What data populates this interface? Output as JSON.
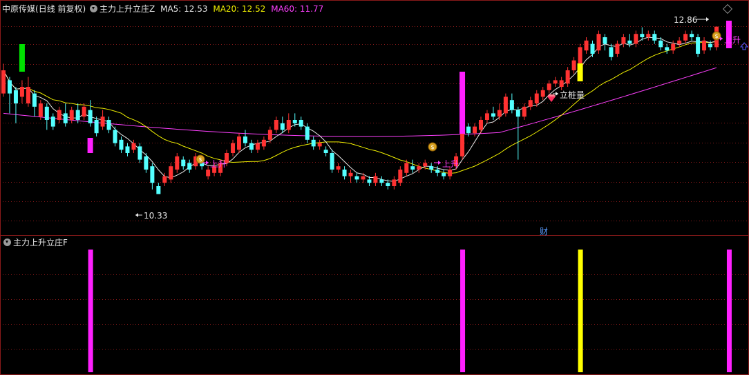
{
  "main_panel": {
    "stock_name": "中原传媒",
    "period": "(日线 前复权)",
    "indicator": "主力上升立庄Z",
    "ma5": "MA5: 12.53",
    "ma20": "MA20: 12.52",
    "ma60": "MA60: 11.77",
    "high_label": "12.86",
    "low_label": "10.33",
    "signal_rise": "上升",
    "signal_stake": "立桩量",
    "finance_marker": "财"
  },
  "sub_panel": {
    "indicator": "主力上升立庄F"
  },
  "colors": {
    "up": "#ff3232",
    "down": "#54ffff",
    "ma5": "#e8e8e8",
    "ma20": "#f0f000",
    "ma60": "#ff40ff",
    "grid": "#8b1a1a",
    "signal_magenta": "#ff20ff",
    "signal_yellow": "#ffff00",
    "signal_green": "#00e000"
  },
  "icons": [
    "circle-dropdown-icon",
    "money-bag-icon",
    "gem-icon",
    "diamond-icon",
    "arrow-up-icon"
  ],
  "price_scale": {
    "min": 10.33,
    "max": 12.86
  },
  "candles": [
    [
      11.85,
      12.2,
      12.3,
      11.8
    ],
    [
      12.05,
      11.85,
      12.1,
      11.55
    ],
    [
      11.9,
      11.7,
      11.95,
      11.4
    ],
    [
      11.8,
      11.95,
      12.05,
      11.7
    ],
    [
      11.7,
      11.95,
      12.1,
      11.65
    ],
    [
      11.85,
      11.65,
      11.9,
      11.5
    ],
    [
      11.5,
      11.7,
      11.75,
      11.45
    ],
    [
      11.65,
      11.45,
      11.7,
      11.3
    ],
    [
      11.5,
      11.35,
      11.55,
      11.3
    ],
    [
      11.45,
      11.6,
      11.65,
      11.4
    ],
    [
      11.55,
      11.4,
      11.7,
      11.35
    ],
    [
      11.45,
      11.6,
      11.65,
      11.4
    ],
    [
      11.6,
      11.45,
      11.7,
      11.4
    ],
    [
      11.5,
      11.65,
      11.7,
      11.45
    ],
    [
      11.6,
      11.4,
      11.75,
      11.35
    ],
    [
      11.45,
      11.25,
      11.5,
      11.2
    ],
    [
      11.35,
      11.5,
      11.6,
      11.3
    ],
    [
      11.45,
      11.3,
      11.5,
      11.25
    ],
    [
      11.3,
      11.1,
      11.35,
      11.05
    ],
    [
      11.15,
      11.0,
      11.2,
      10.95
    ],
    [
      11.05,
      10.95,
      11.1,
      10.9
    ],
    [
      11.0,
      11.1,
      11.15,
      10.95
    ],
    [
      11.05,
      10.85,
      11.1,
      10.8
    ],
    [
      10.9,
      10.7,
      10.95,
      10.65
    ],
    [
      10.75,
      10.5,
      10.8,
      10.4
    ],
    [
      10.45,
      10.33,
      10.5,
      10.33
    ],
    [
      10.5,
      10.6,
      10.65,
      10.45
    ],
    [
      10.55,
      10.75,
      10.8,
      10.5
    ],
    [
      10.7,
      10.9,
      10.95,
      10.65
    ],
    [
      10.85,
      10.75,
      10.9,
      10.7
    ],
    [
      10.8,
      10.7,
      10.85,
      10.65
    ],
    [
      10.75,
      10.9,
      10.95,
      10.7
    ],
    [
      10.85,
      10.75,
      10.9,
      10.7
    ],
    [
      10.6,
      10.7,
      10.75,
      10.55
    ],
    [
      10.65,
      10.75,
      10.8,
      10.6
    ],
    [
      10.65,
      10.8,
      10.85,
      10.6
    ],
    [
      10.8,
      10.95,
      11.0,
      10.75
    ],
    [
      10.95,
      11.1,
      11.15,
      10.9
    ],
    [
      11.0,
      11.2,
      11.25,
      10.95
    ],
    [
      11.2,
      11.1,
      11.3,
      11.05
    ],
    [
      11.1,
      11.0,
      11.15,
      10.95
    ],
    [
      11.0,
      11.1,
      11.15,
      10.95
    ],
    [
      11.05,
      11.15,
      11.2,
      11.0
    ],
    [
      11.15,
      11.3,
      11.35,
      11.1
    ],
    [
      11.3,
      11.45,
      11.5,
      11.25
    ],
    [
      11.4,
      11.3,
      11.5,
      11.25
    ],
    [
      11.3,
      11.45,
      11.55,
      11.25
    ],
    [
      11.45,
      11.4,
      11.55,
      11.35
    ],
    [
      11.45,
      11.35,
      11.5,
      11.3
    ],
    [
      11.35,
      11.15,
      11.4,
      11.1
    ],
    [
      11.15,
      11.05,
      11.2,
      11.0
    ],
    [
      11.05,
      11.1,
      11.15,
      11.0
    ],
    [
      11.0,
      10.95,
      11.05,
      10.9
    ],
    [
      10.95,
      10.7,
      11.0,
      10.65
    ],
    [
      10.7,
      10.75,
      10.8,
      10.65
    ],
    [
      10.7,
      10.6,
      10.75,
      10.55
    ],
    [
      10.6,
      10.65,
      10.7,
      10.5
    ],
    [
      10.6,
      10.55,
      10.65,
      10.5
    ],
    [
      10.55,
      10.6,
      10.65,
      10.5
    ],
    [
      10.55,
      10.5,
      10.6,
      10.45
    ],
    [
      10.5,
      10.6,
      10.65,
      10.45
    ],
    [
      10.55,
      10.5,
      10.6,
      10.45
    ],
    [
      10.5,
      10.45,
      10.55,
      10.4
    ],
    [
      10.45,
      10.55,
      10.6,
      10.4
    ],
    [
      10.5,
      10.7,
      10.75,
      10.45
    ],
    [
      10.65,
      10.8,
      10.85,
      10.6
    ],
    [
      10.75,
      10.7,
      10.85,
      10.65
    ],
    [
      10.7,
      10.75,
      10.8,
      10.65
    ],
    [
      10.75,
      10.8,
      10.85,
      10.7
    ],
    [
      10.75,
      10.7,
      10.8,
      10.65
    ],
    [
      10.7,
      10.65,
      10.75,
      10.6
    ],
    [
      10.65,
      10.6,
      10.7,
      10.55
    ],
    [
      10.6,
      10.7,
      10.75,
      10.55
    ],
    [
      10.75,
      10.9,
      10.95,
      10.7
    ],
    [
      10.9,
      11.4,
      11.45,
      10.85
    ],
    [
      11.35,
      11.25,
      11.4,
      11.2
    ],
    [
      11.25,
      11.35,
      11.4,
      11.2
    ],
    [
      11.3,
      11.45,
      11.5,
      11.25
    ],
    [
      11.45,
      11.55,
      11.6,
      11.4
    ],
    [
      11.55,
      11.5,
      11.65,
      11.45
    ],
    [
      11.5,
      11.6,
      11.7,
      11.45
    ],
    [
      11.55,
      11.8,
      11.85,
      11.5
    ],
    [
      11.75,
      11.6,
      11.85,
      11.55
    ],
    [
      11.6,
      11.5,
      11.65,
      10.85
    ],
    [
      11.5,
      11.65,
      11.7,
      11.45
    ],
    [
      11.65,
      11.75,
      11.8,
      11.6
    ],
    [
      11.7,
      11.85,
      11.9,
      11.65
    ],
    [
      11.8,
      11.9,
      11.95,
      11.75
    ],
    [
      11.9,
      12.0,
      12.05,
      11.85
    ],
    [
      12.0,
      12.05,
      12.1,
      11.95
    ],
    [
      11.95,
      12.05,
      12.1,
      11.9
    ],
    [
      12.0,
      12.2,
      12.25,
      11.95
    ],
    [
      12.2,
      12.35,
      12.4,
      12.15
    ],
    [
      12.3,
      12.55,
      12.6,
      12.25
    ],
    [
      12.5,
      12.65,
      12.7,
      12.45
    ],
    [
      12.6,
      12.45,
      12.65,
      12.4
    ],
    [
      12.5,
      12.75,
      12.8,
      12.45
    ],
    [
      12.7,
      12.6,
      12.75,
      12.5
    ],
    [
      12.55,
      12.4,
      12.6,
      12.35
    ],
    [
      12.45,
      12.6,
      12.65,
      12.4
    ],
    [
      12.6,
      12.7,
      12.75,
      12.55
    ],
    [
      12.65,
      12.6,
      12.75,
      12.55
    ],
    [
      12.6,
      12.75,
      12.8,
      12.55
    ],
    [
      12.75,
      12.7,
      12.85,
      12.65
    ],
    [
      12.7,
      12.75,
      12.8,
      12.65
    ],
    [
      12.75,
      12.65,
      12.8,
      12.6
    ],
    [
      12.65,
      12.55,
      12.7,
      12.5
    ],
    [
      12.55,
      12.5,
      12.6,
      12.45
    ],
    [
      12.5,
      12.6,
      12.65,
      12.45
    ],
    [
      12.6,
      12.65,
      12.7,
      12.55
    ],
    [
      12.65,
      12.75,
      12.8,
      12.6
    ],
    [
      12.75,
      12.7,
      12.8,
      12.65
    ],
    [
      12.7,
      12.45,
      12.75,
      12.4
    ],
    [
      12.5,
      12.65,
      12.7,
      12.45
    ],
    [
      12.6,
      12.55,
      12.65,
      12.5
    ],
    [
      12.55,
      12.86,
      12.86,
      12.5
    ]
  ],
  "signals": [
    {
      "candle": 14,
      "color": "magenta"
    },
    {
      "candle": 74,
      "color": "magenta"
    },
    {
      "candle": 93,
      "color": "yellow"
    },
    {
      "candle": 117,
      "color": "magenta"
    }
  ]
}
